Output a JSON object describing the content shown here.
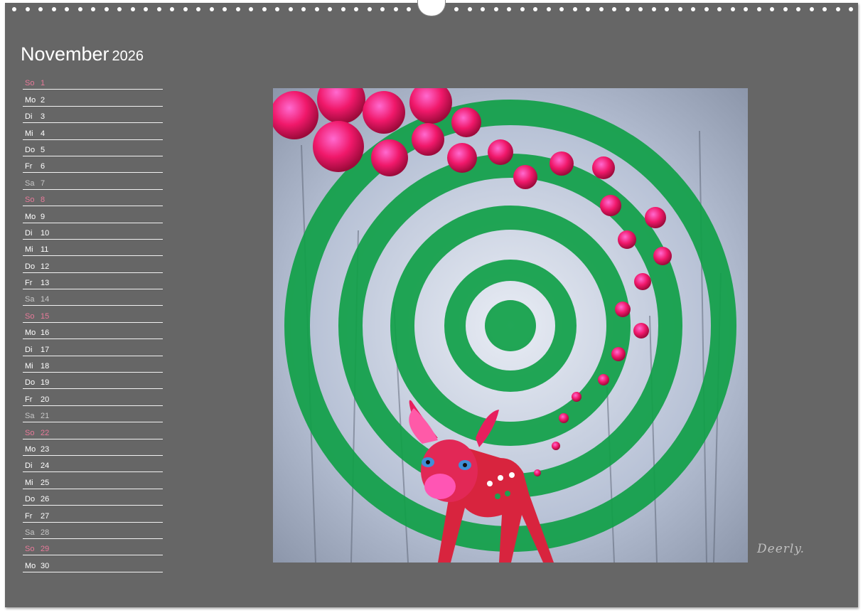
{
  "calendar": {
    "month": "November",
    "year": "2026",
    "days": [
      {
        "weekday": "So",
        "date": "1",
        "type": "sun"
      },
      {
        "weekday": "Mo",
        "date": "2",
        "type": "wd"
      },
      {
        "weekday": "Di",
        "date": "3",
        "type": "wd"
      },
      {
        "weekday": "Mi",
        "date": "4",
        "type": "wd"
      },
      {
        "weekday": "Do",
        "date": "5",
        "type": "wd"
      },
      {
        "weekday": "Fr",
        "date": "6",
        "type": "wd"
      },
      {
        "weekday": "Sa",
        "date": "7",
        "type": "sat"
      },
      {
        "weekday": "So",
        "date": "8",
        "type": "sun"
      },
      {
        "weekday": "Mo",
        "date": "9",
        "type": "wd"
      },
      {
        "weekday": "Di",
        "date": "10",
        "type": "wd"
      },
      {
        "weekday": "Mi",
        "date": "11",
        "type": "wd"
      },
      {
        "weekday": "Do",
        "date": "12",
        "type": "wd"
      },
      {
        "weekday": "Fr",
        "date": "13",
        "type": "wd"
      },
      {
        "weekday": "Sa",
        "date": "14",
        "type": "sat"
      },
      {
        "weekday": "So",
        "date": "15",
        "type": "sun"
      },
      {
        "weekday": "Mo",
        "date": "16",
        "type": "wd"
      },
      {
        "weekday": "Di",
        "date": "17",
        "type": "wd"
      },
      {
        "weekday": "Mi",
        "date": "18",
        "type": "wd"
      },
      {
        "weekday": "Do",
        "date": "19",
        "type": "wd"
      },
      {
        "weekday": "Fr",
        "date": "20",
        "type": "wd"
      },
      {
        "weekday": "Sa",
        "date": "21",
        "type": "sat"
      },
      {
        "weekday": "So",
        "date": "22",
        "type": "sun"
      },
      {
        "weekday": "Mo",
        "date": "23",
        "type": "wd"
      },
      {
        "weekday": "Di",
        "date": "24",
        "type": "wd"
      },
      {
        "weekday": "Mi",
        "date": "25",
        "type": "wd"
      },
      {
        "weekday": "Do",
        "date": "26",
        "type": "wd"
      },
      {
        "weekday": "Fr",
        "date": "27",
        "type": "wd"
      },
      {
        "weekday": "Sa",
        "date": "28",
        "type": "sat"
      },
      {
        "weekday": "So",
        "date": "29",
        "type": "sun"
      },
      {
        "weekday": "Mo",
        "date": "30",
        "type": "wd"
      }
    ]
  },
  "artwork": {
    "signature": "Deerly."
  },
  "colors": {
    "page_background": "#666666",
    "ring_green": "#10a048",
    "ball_pink": "#ff2a6a",
    "sunday_text": "#e87a9a"
  }
}
